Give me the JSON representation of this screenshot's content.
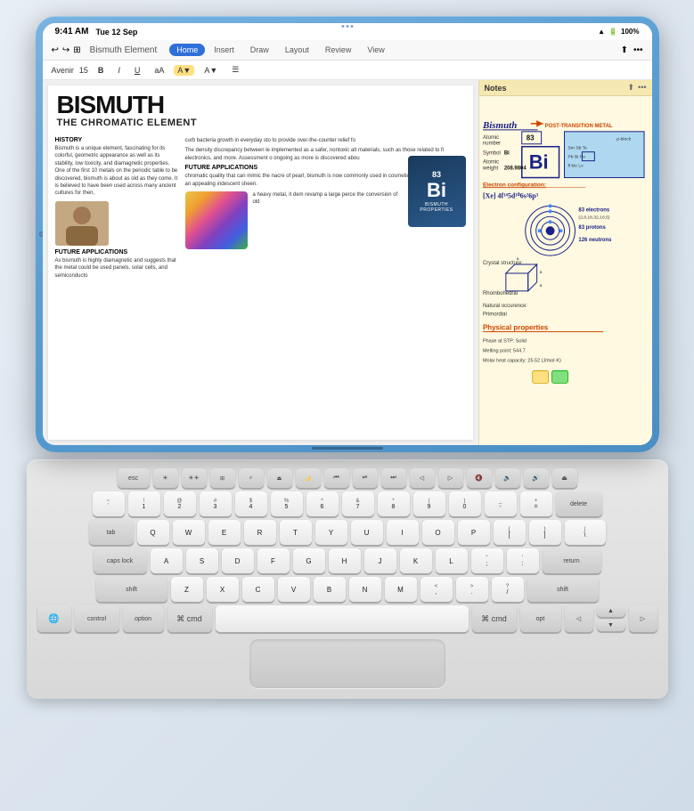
{
  "device": {
    "status_bar": {
      "time": "9:41 AM",
      "date": "Tue 12 Sep",
      "wifi": "WiFi",
      "battery": "100%"
    },
    "app": "Pages"
  },
  "toolbar": {
    "breadcrumb": "Bismuth Element",
    "tabs": [
      "Home",
      "Insert",
      "Draw",
      "Layout",
      "Review",
      "View"
    ],
    "active_tab": "Home",
    "font": "Avenir",
    "size": "15"
  },
  "document": {
    "title": "BISMUTH",
    "subtitle": "THE CHROMATIC ELEMENT",
    "sections": {
      "history_title": "HISTORY",
      "history_text": "Bismuth is a unique element, fascinating for its colorful, geometric appearance as well as its stability, low toxicity, and diamagnetic properties. One of the first 10 metals on the periodic table to be discovered, bismuth is about as old as they come. It is believed to have been used across many ancient cultures for then,",
      "applications_title": "FUTURE APPLICATIONS",
      "applications_text": "As bismuth is highly diamagnetic and suggests that the metal could be used panels, solar cells, and semiconducto",
      "body_text_1": "curb bacteria growth in everyday sto to provide over-the-counter relief fo",
      "body_text_2": "The density discrepancy between le implemented as a safer, nontoxic alt materials, such as those related to fi electronics, and more. Assessment o ongoing as more is discovered abou",
      "body_text_3": "chromatic quality that can mimic the nacre of pearl, bismuth is now commonly used in cosmetics and pigments to lend an appealing iridescent sheen.",
      "body_text_4": "a heavy metal, it dem revamp a large perce the conversion of old",
      "element_card": {
        "atomic_number": "83",
        "symbol": "Bi",
        "name": "Bismuth",
        "subtitle": "PROPERTIES"
      }
    }
  },
  "notes": {
    "title": "Notes",
    "header": "Bismuth",
    "arrow_text": "POST-TRANSITION METAL",
    "properties": [
      {
        "label": "Atomic number",
        "value": "83"
      },
      {
        "label": "Symbol",
        "value": "Bi"
      },
      {
        "label": "Atomic weight",
        "value": "208.9804"
      }
    ],
    "periodic_box": "Bi",
    "periodic_table_labels": [
      "p-block",
      "Sm|Sb|Te",
      "Pb|Bi|Po",
      "fl|Mc|Lv"
    ],
    "electron_config_label": "Electron configuration:",
    "electron_config": "[Xe] 4f¹⁴ 5d¹⁰ 6s² 6p³",
    "atom_facts": [
      "83 electrons (2,8,18,32,18,5)",
      "83 protons",
      "126 neutrons"
    ],
    "crystal_structure": "Rhombohedral",
    "natural_occurrence": "Primordial",
    "physical_props_title": "Physical properties",
    "phase_at_stp": "Solid",
    "melting_point": "544.7",
    "molar_heat_capacity": "25.52"
  },
  "keyboard": {
    "fn_row": [
      "esc",
      "☀",
      "☀",
      "⊞",
      "⌕",
      "⏏",
      "🌙",
      "◀◀",
      "▶⏸",
      "▶▶",
      "◁",
      "▷",
      "🔇",
      "🔉",
      "🔊",
      "⏏"
    ],
    "row1": [
      "~`",
      "!1",
      "@2",
      "#3",
      "$4",
      "%5",
      "^6",
      "&7",
      "*8",
      "(9",
      ")0",
      "-_",
      "+=",
      "delete"
    ],
    "row2": [
      "tab",
      "Q",
      "W",
      "E",
      "R",
      "T",
      "Y",
      "U",
      "I",
      "O",
      "P",
      "[{",
      "]}",
      "|\\"
    ],
    "row3": [
      "caps lock",
      "A",
      "S",
      "D",
      "F",
      "G",
      "H",
      "J",
      "K",
      "L",
      ";:",
      "'\"",
      "return"
    ],
    "row4": [
      "shift",
      "Z",
      "X",
      "C",
      "V",
      "B",
      "N",
      "M",
      "<,",
      ">.",
      "?/",
      "shift"
    ],
    "row5": [
      "🌐",
      "control",
      "option",
      "cmd",
      "space",
      "cmd",
      "opt",
      "◁",
      "▲▼",
      "▷"
    ],
    "option_label": "option"
  }
}
